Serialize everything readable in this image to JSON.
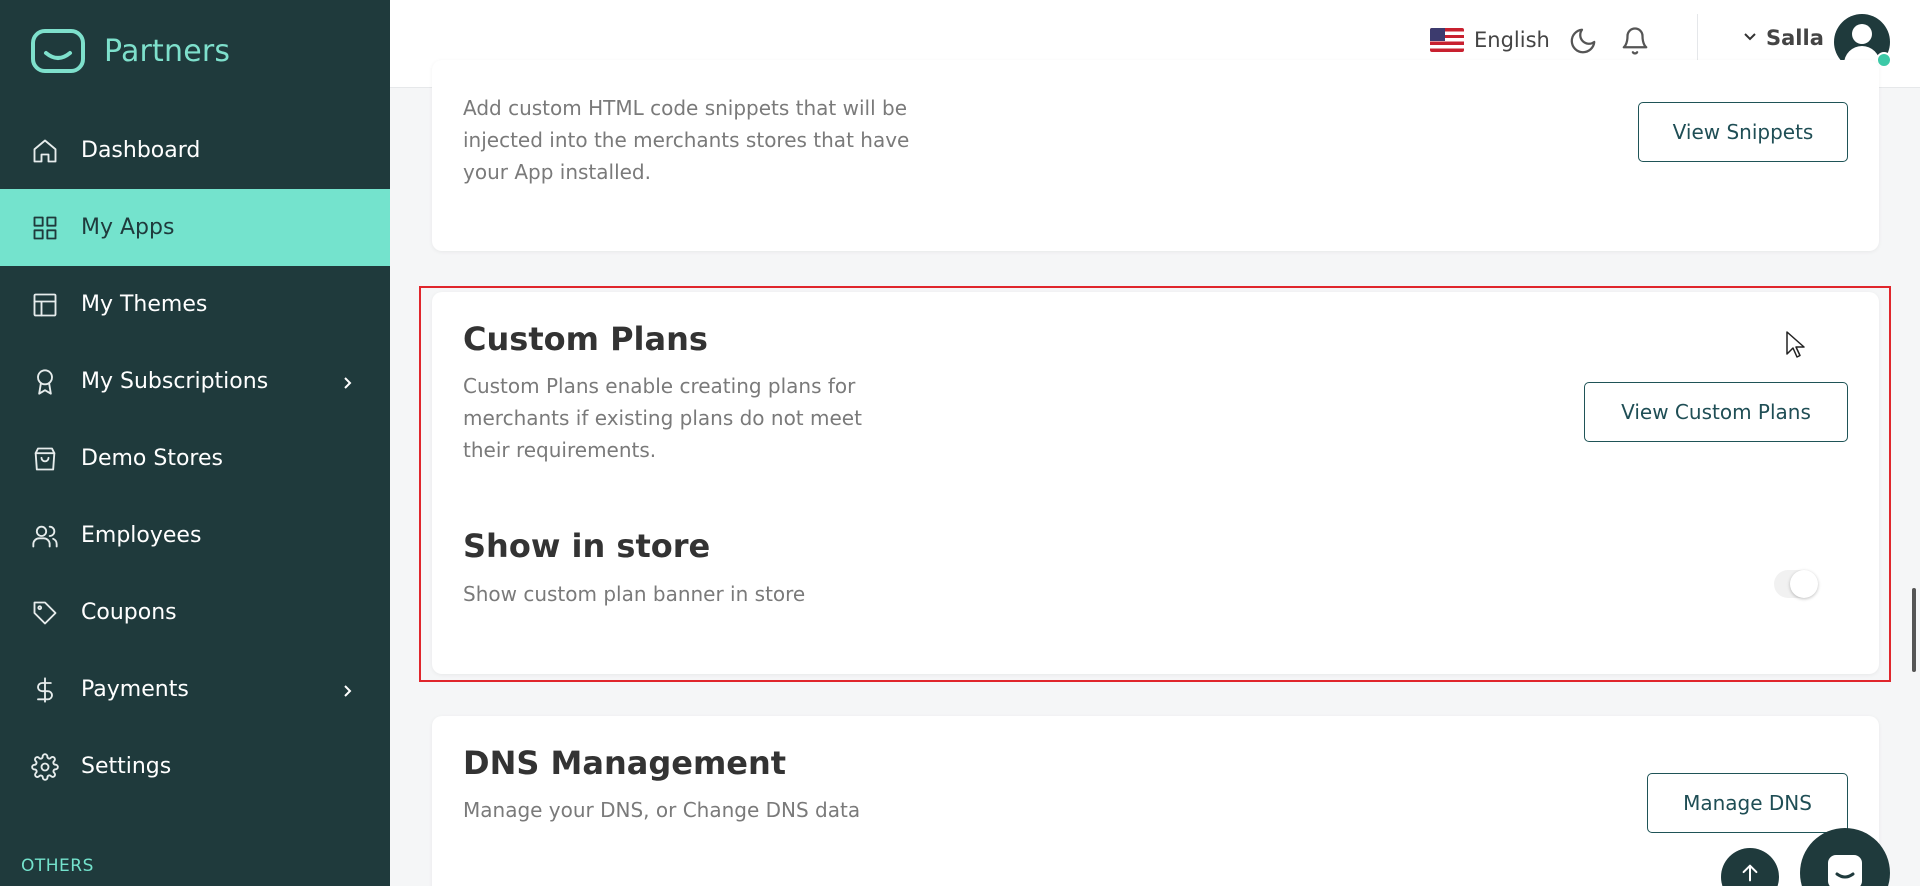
{
  "brand": {
    "name": "Partners",
    "icon": "partners-logo"
  },
  "sidebar": {
    "items": [
      {
        "label": "Dashboard",
        "icon": "home-icon"
      },
      {
        "label": "My Apps",
        "icon": "grid-icon",
        "active": true
      },
      {
        "label": "My Themes",
        "icon": "layout-icon"
      },
      {
        "label": "My Subscriptions",
        "icon": "award-icon",
        "has_children": true
      },
      {
        "label": "Demo Stores",
        "icon": "shopping-bag-icon"
      },
      {
        "label": "Employees",
        "icon": "users-icon"
      },
      {
        "label": "Coupons",
        "icon": "tag-icon"
      },
      {
        "label": "Payments",
        "icon": "dollar-icon",
        "has_children": true
      },
      {
        "label": "Settings",
        "icon": "gear-icon"
      }
    ],
    "section_label": "OTHERS"
  },
  "header": {
    "language": "English",
    "user_name": "Salla",
    "icons": [
      "us-flag-icon",
      "moon-icon",
      "bell-icon",
      "chevron-down-icon",
      "avatar"
    ]
  },
  "snippets": {
    "description": "Add custom HTML code snippets that will be injected into the merchants stores that have your App installed.",
    "button": "View Snippets"
  },
  "custom_plans": {
    "title": "Custom Plans",
    "description": "Custom Plans enable creating plans for merchants if existing plans do not meet their requirements.",
    "button": "View Custom Plans",
    "show_in_store_title": "Show in store",
    "show_in_store_description": "Show custom plan banner in store",
    "show_in_store_enabled": false
  },
  "dns": {
    "title": "DNS Management",
    "description": "Manage your DNS, or Change DNS data",
    "button": "Manage DNS"
  },
  "colors": {
    "sidebar_bg": "#1f3a3c",
    "accent": "#74e3cd",
    "highlight_border": "#e0262c"
  }
}
